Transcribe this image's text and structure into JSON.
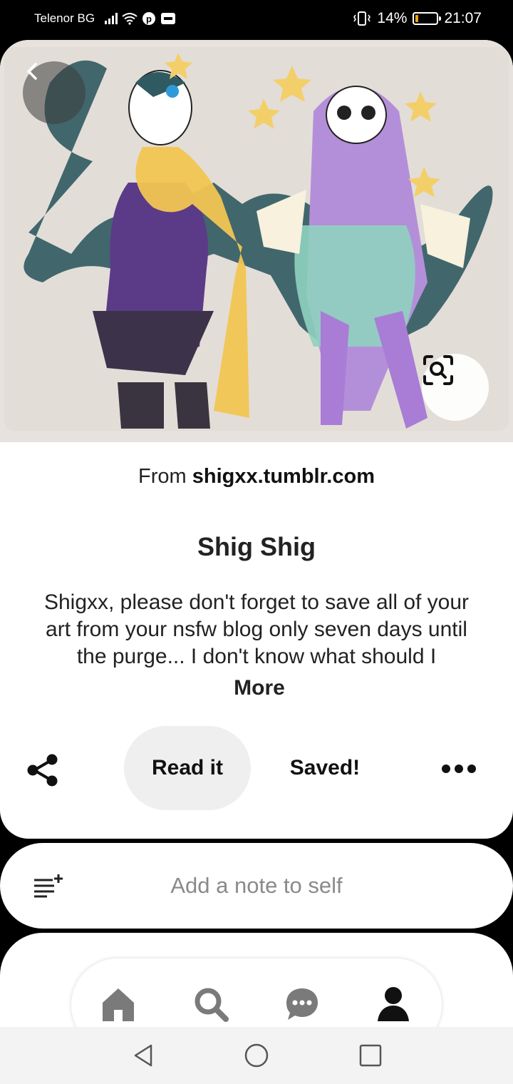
{
  "status_bar": {
    "carrier": "Telenor BG",
    "battery_percent": "14%",
    "battery_level": 0.14,
    "time": "21:07"
  },
  "pin": {
    "source_prefix": "From",
    "source_domain": "shigxx.tumblr.com",
    "title": "Shig Shig",
    "description": "Shigxx, please don't forget to save all of your art from your nsfw blog only seven days until the purge... I don't know what should I",
    "more_label": "More"
  },
  "actions": {
    "read_label": "Read it",
    "saved_label": "Saved!"
  },
  "note": {
    "placeholder": "Add a note to self"
  },
  "colors": {
    "accent_orange": "#f1a512",
    "button_grey": "#efefef",
    "text_dark": "#111111",
    "placeholder_grey": "#8a8a8a"
  },
  "icons": {
    "back": "chevron-left-icon",
    "visual_search": "visual-search-icon",
    "share": "share-icon",
    "more": "more-horizontal-icon",
    "note": "add-note-icon",
    "home": "home-icon",
    "search": "search-icon",
    "messages": "chat-bubble-icon",
    "profile": "profile-icon"
  }
}
